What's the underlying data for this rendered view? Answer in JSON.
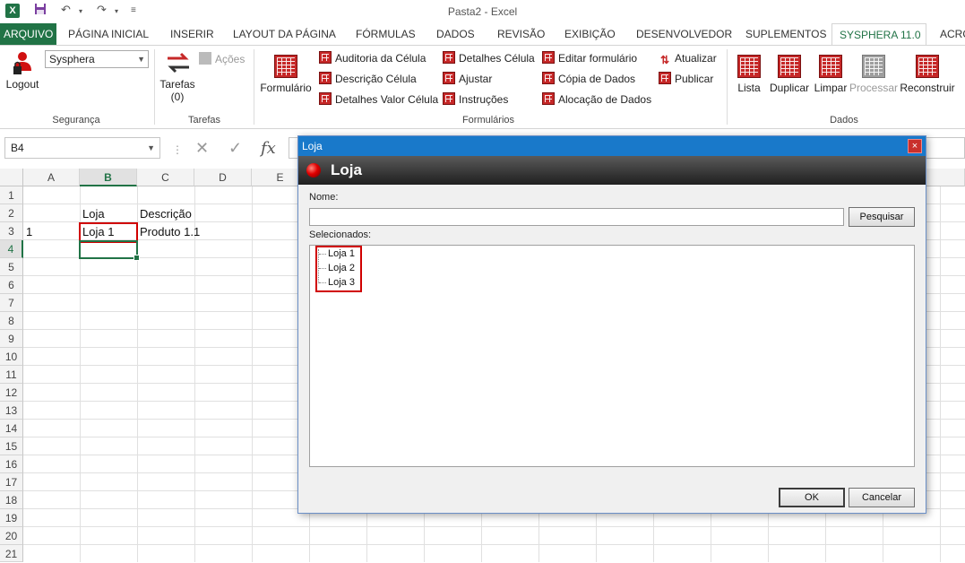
{
  "window": {
    "title": "Pasta2 - Excel",
    "app_icon": "X"
  },
  "tabs": [
    {
      "label": "ARQUIVO"
    },
    {
      "label": "PÁGINA INICIAL"
    },
    {
      "label": "INSERIR"
    },
    {
      "label": "LAYOUT DA PÁGINA"
    },
    {
      "label": "FÓRMULAS"
    },
    {
      "label": "DADOS"
    },
    {
      "label": "REVISÃO"
    },
    {
      "label": "EXIBIÇÃO"
    },
    {
      "label": "DESENVOLVEDOR"
    },
    {
      "label": "SUPLEMENTOS"
    },
    {
      "label": "SYSPHERA 11.0"
    },
    {
      "label": "ACRO"
    }
  ],
  "ribbon": {
    "seguranca": {
      "group_label": "Segurança",
      "combo_value": "Sysphera",
      "logout_label": "Logout"
    },
    "tarefas": {
      "group_label": "Tarefas",
      "tarefas_label": "Tarefas",
      "tarefas_count": "(0)",
      "acoes_label": "Ações"
    },
    "formularios": {
      "group_label": "Formulários",
      "formulario_label": "Formulário",
      "col1": [
        "Auditoria da Célula",
        "Descrição Célula",
        "Detalhes Valor Célula"
      ],
      "col2": [
        "Detalhes Célula",
        "Ajustar",
        "Instruções"
      ],
      "col3": [
        "Editar formulário",
        "Cópia de Dados",
        "Alocação de Dados"
      ],
      "col4": [
        "Atualizar",
        "Publicar"
      ]
    },
    "dados": {
      "group_label": "Dados",
      "lista": "Lista",
      "duplicar": "Duplicar",
      "limpar": "Limpar",
      "processar": "Processar",
      "reconstruir": "Reconstruir"
    }
  },
  "formula_bar": {
    "name_box": "B4",
    "fx": "fx"
  },
  "sheet": {
    "columns": [
      "A",
      "B",
      "C",
      "D",
      "E"
    ],
    "rows": [
      "1",
      "2",
      "3",
      "4",
      "5",
      "6",
      "7",
      "8",
      "9",
      "10",
      "11",
      "12",
      "13",
      "14",
      "15",
      "16",
      "17",
      "18",
      "19",
      "20",
      "21"
    ],
    "cells": {
      "B2": "Loja",
      "C2": "Descrição",
      "A3": "1",
      "B3": "Loja 1",
      "C3": "Produto 1.1"
    }
  },
  "dialog": {
    "title": "Loja",
    "header": "Loja",
    "close": "×",
    "nome_label": "Nome:",
    "search_button": "Pesquisar",
    "selected_label": "Selecionados:",
    "items": [
      "Loja 1",
      "Loja 2",
      "Loja 3"
    ],
    "ok_button": "OK",
    "cancel_button": "Cancelar"
  }
}
